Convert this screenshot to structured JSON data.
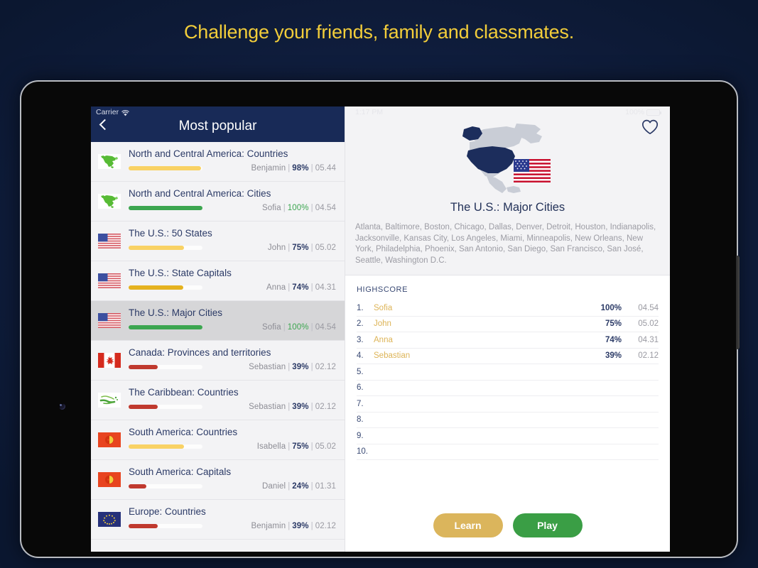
{
  "headline": "Challenge your friends, family and classmates.",
  "theme": {
    "page_bg": "#0b1730",
    "headline_color": "#f2cd3a",
    "navbar_color": "#182a57",
    "accent_gold": "#dbb55c",
    "accent_green": "#3a9e45",
    "perfect_green": "#3ca650"
  },
  "status_bar": {
    "carrier": "Carrier",
    "wifi_icon": "wifi-icon",
    "time": "1:17 PM",
    "battery_percent": "100%",
    "battery_icon": "battery-full-icon"
  },
  "left_pane": {
    "back_icon": "chevron-left-icon",
    "title": "Most popular",
    "quizzes": [
      {
        "flag": "north-america-map-icon",
        "title": "North and Central America: Countries",
        "player": "Benjamin",
        "percent": "98%",
        "time": "05.44",
        "progress": 98,
        "bar_color": "#f9d264",
        "perfect": false
      },
      {
        "flag": "north-america-map-icon",
        "title": "North and Central America: Cities",
        "player": "Sofia",
        "percent": "100%",
        "time": "04.54",
        "progress": 100,
        "bar_color": "#3ca650",
        "perfect": true
      },
      {
        "flag": "us-flag-icon",
        "title": "The U.S.: 50 States",
        "player": "John",
        "percent": "75%",
        "time": "05.02",
        "progress": 75,
        "bar_color": "#f9d264",
        "perfect": false
      },
      {
        "flag": "us-flag-icon",
        "title": "The U.S.: State Capitals",
        "player": "Anna",
        "percent": "74%",
        "time": "04.31",
        "progress": 74,
        "bar_color": "#e5b21f",
        "perfect": false
      },
      {
        "flag": "us-flag-icon",
        "title": "The U.S.: Major Cities",
        "player": "Sofia",
        "percent": "100%",
        "time": "04.54",
        "progress": 100,
        "bar_color": "#3ca650",
        "perfect": true,
        "selected": true
      },
      {
        "flag": "canada-flag-icon",
        "title": "Canada: Provinces and territories",
        "player": "Sebastian",
        "percent": "39%",
        "time": "02.12",
        "progress": 39,
        "bar_color": "#c0392e",
        "perfect": false
      },
      {
        "flag": "caribbean-map-icon",
        "title": "The Caribbean: Countries",
        "player": "Sebastian",
        "percent": "39%",
        "time": "02.12",
        "progress": 39,
        "bar_color": "#c0392e",
        "perfect": false
      },
      {
        "flag": "south-america-flag-icon",
        "title": "South America: Countries",
        "player": "Isabella",
        "percent": "75%",
        "time": "05.02",
        "progress": 75,
        "bar_color": "#f9d264",
        "perfect": false
      },
      {
        "flag": "south-america-flag-icon",
        "title": "South America: Capitals",
        "player": "Daniel",
        "percent": "24%",
        "time": "01.31",
        "progress": 24,
        "bar_color": "#c0392e",
        "perfect": false
      },
      {
        "flag": "europe-flag-icon",
        "title": "Europe: Countries",
        "player": "Benjamin",
        "percent": "39%",
        "time": "02.12",
        "progress": 39,
        "bar_color": "#c0392e",
        "perfect": false
      }
    ]
  },
  "right_pane": {
    "favorite_icon": "heart-outline-icon",
    "map_icon": "usa-highlighted-north-america-map",
    "title": "The U.S.: Major Cities",
    "description": "Atlanta, Baltimore, Boston, Chicago, Dallas, Denver, Detroit, Houston, Indianapolis, Jacksonville, Kansas City, Los Angeles, Miami, Minneapolis, New Orleans, New York, Philadelphia, Phoenix, San Antonio, San Diego, San Francisco, San José, Seattle, Washington D.C.",
    "highscore_label": "HIGHSCORE",
    "highscores": [
      {
        "rank": "1.",
        "name": "Sofia",
        "percent": "100%",
        "time": "04.54"
      },
      {
        "rank": "2.",
        "name": "John",
        "percent": "75%",
        "time": "05.02"
      },
      {
        "rank": "3.",
        "name": "Anna",
        "percent": "74%",
        "time": "04.31"
      },
      {
        "rank": "4.",
        "name": "Sebastian",
        "percent": "39%",
        "time": "02.12"
      },
      {
        "rank": "5.",
        "name": "",
        "percent": "",
        "time": ""
      },
      {
        "rank": "6.",
        "name": "",
        "percent": "",
        "time": ""
      },
      {
        "rank": "7.",
        "name": "",
        "percent": "",
        "time": ""
      },
      {
        "rank": "8.",
        "name": "",
        "percent": "",
        "time": ""
      },
      {
        "rank": "9.",
        "name": "",
        "percent": "",
        "time": ""
      },
      {
        "rank": "10.",
        "name": "",
        "percent": "",
        "time": ""
      }
    ],
    "learn_button": "Learn",
    "play_button": "Play"
  }
}
